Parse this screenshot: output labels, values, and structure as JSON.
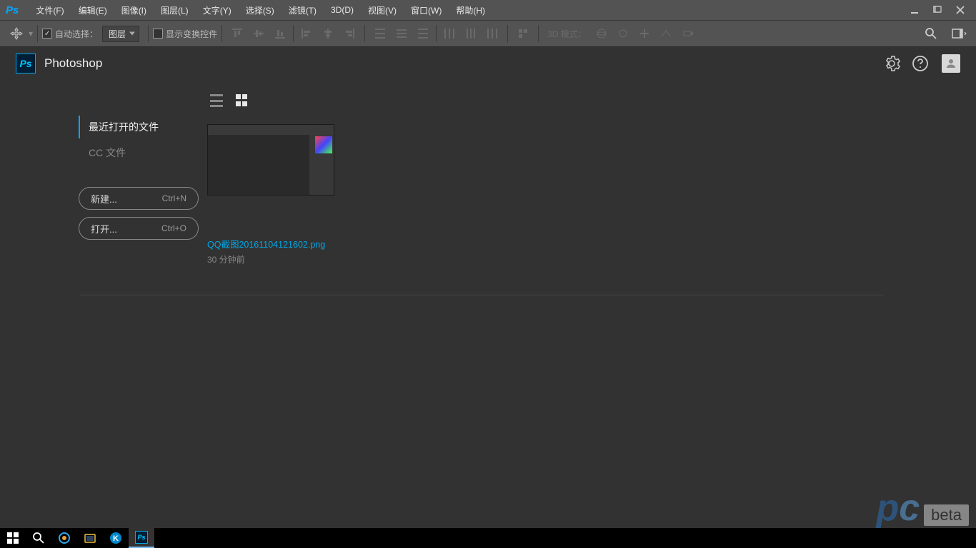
{
  "app_logo": "Ps",
  "app_title": "Photoshop",
  "menu": [
    "文件(F)",
    "编辑(E)",
    "图像(I)",
    "图层(L)",
    "文字(Y)",
    "选择(S)",
    "滤镜(T)",
    "3D(D)",
    "视图(V)",
    "窗口(W)",
    "帮助(H)"
  ],
  "options": {
    "auto_select_label": "自动选择：",
    "auto_select_checked": true,
    "auto_select_value": "图层",
    "show_transform_label": "显示变换控件",
    "show_transform_checked": false,
    "mode3d_label": "3D 模式："
  },
  "sidebar": {
    "recent_label": "最近打开的文件",
    "cc_label": "CC 文件",
    "new_label": "新建...",
    "new_kbd": "Ctrl+N",
    "open_label": "打开...",
    "open_kbd": "Ctrl+O"
  },
  "recent": [
    {
      "name": "QQ截图20161104121602.png",
      "time": "30 分钟前"
    }
  ],
  "watermark": {
    "pc_p": "p",
    "pc_c": "c",
    "beta": "beta"
  }
}
